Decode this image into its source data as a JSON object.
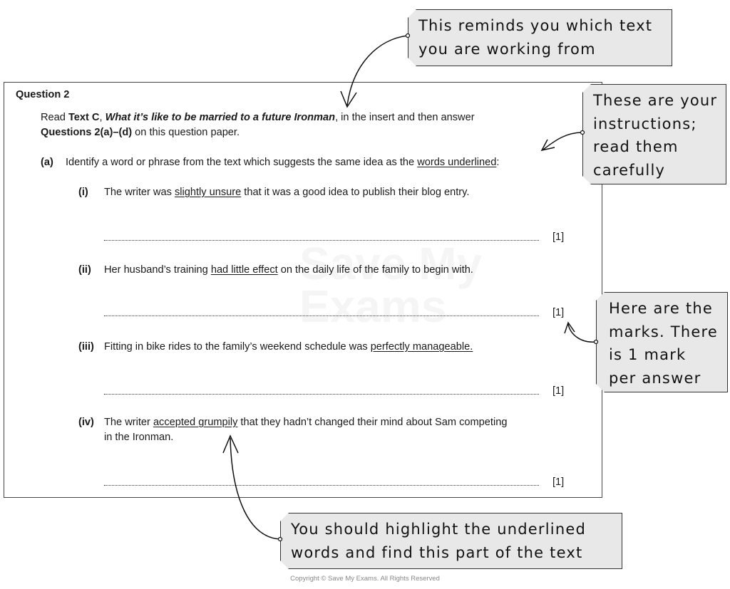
{
  "question": {
    "title": "Question 2",
    "intro": {
      "read": "Read ",
      "text_label": "Text C",
      "comma": ", ",
      "text_title": "What it’s like to be married to a future Ironman",
      "rest": ", in the insert and then answer",
      "questions": "Questions 2(a)–(d)",
      "rest2": " on this question paper."
    },
    "part_a": {
      "label": "(a)",
      "text": "Identify a word or phrase from the text which suggests the same idea as the ",
      "underlined": "words underlined",
      "end": ":"
    },
    "items": [
      {
        "label": "(i)",
        "before": "The writer was ",
        "underlined": "slightly unsure",
        "after": " that it was a good idea to publish their blog entry.",
        "line2": "",
        "mark": "[1]"
      },
      {
        "label": "(ii)",
        "before": "Her husband’s training ",
        "underlined": "had little effect",
        "after": " on the daily life of the family to begin with.",
        "line2": "",
        "mark": "[1]"
      },
      {
        "label": "(iii)",
        "before": "Fitting in bike rides to the family’s weekend schedule was ",
        "underlined": "perfectly manageable.",
        "after": "",
        "line2": "",
        "mark": "[1]"
      },
      {
        "label": "(iv)",
        "before": "The writer ",
        "underlined": "accepted grumpily",
        "after": " that they hadn’t changed their mind about Sam competing",
        "line2": "in the Ironman.",
        "mark": "[1]"
      }
    ]
  },
  "watermark": "Save My Exams",
  "callouts": {
    "text": [
      "This reminds you which text",
      "you are working from"
    ],
    "instructions": [
      "These are your",
      "instructions;",
      "read them",
      "carefully"
    ],
    "marks": [
      "Here are the",
      "marks. There",
      "is 1 mark",
      "per answer"
    ],
    "highlight": [
      "You should highlight the underlined",
      "words and find this part of the text"
    ]
  },
  "copyright": "Copyright © Save My Exams. All Rights Reserved",
  "colors": {
    "callout_bg": "#e8e8e8",
    "border": "#333333"
  }
}
